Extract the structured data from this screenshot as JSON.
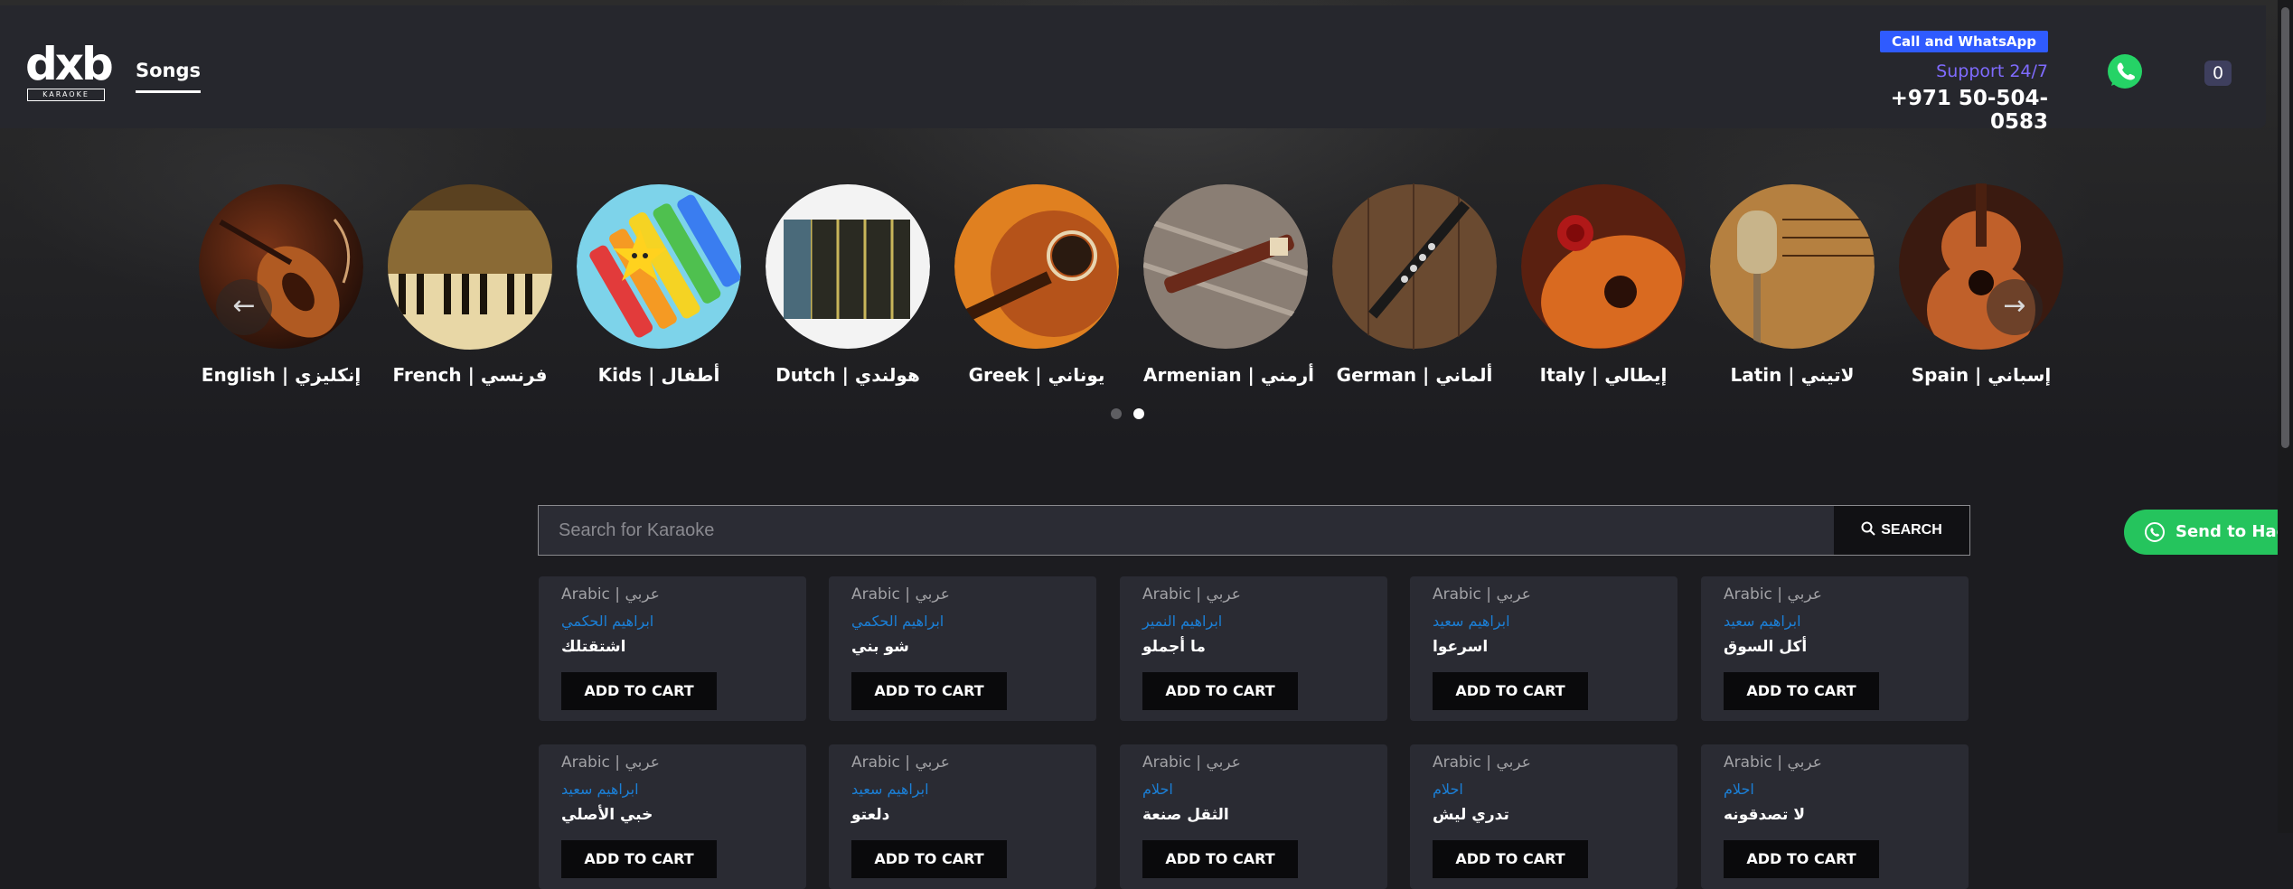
{
  "header": {
    "logo_text": "dxb",
    "logo_sub": "KARAOKE",
    "nav_songs": "Songs",
    "call_badge": "Call and WhatsApp",
    "support": "Support 24/7",
    "phone": "+971 50-504-0583",
    "cart_count": "0",
    "whatsapp_icon": "whatsapp-icon"
  },
  "categories": [
    {
      "label": "English | إنكليزي",
      "icon": "violin"
    },
    {
      "label": "French | فرنسي",
      "icon": "piano"
    },
    {
      "label": "Kids | أطفال",
      "icon": "xylophone"
    },
    {
      "label": "Dutch | هولندي",
      "icon": "accordion"
    },
    {
      "label": "Greek | يوناني",
      "icon": "bouzouki"
    },
    {
      "label": "Armenian | أرمني",
      "icon": "duduk"
    },
    {
      "label": "German | ألماني",
      "icon": "clarinet"
    },
    {
      "label": "Italy | إيطالي",
      "icon": "guitar-rose"
    },
    {
      "label": "Latin | لاتيني",
      "icon": "microphone"
    },
    {
      "label": "Spain | إسباني",
      "icon": "guitar"
    }
  ],
  "carousel": {
    "prev_icon": "arrow-left-icon",
    "next_icon": "arrow-right-icon",
    "pages": 2,
    "active_page": 2
  },
  "search": {
    "placeholder": "Search for Karaoke",
    "button_label": "SEARCH"
  },
  "whatsapp_float": {
    "label": "Send to Hadi"
  },
  "songs": [
    {
      "lang": "Arabic | عربي",
      "artist": "ابراهيم الحكمي",
      "title": "اشتقتلك",
      "button": "ADD TO CART"
    },
    {
      "lang": "Arabic | عربي",
      "artist": "ابراهيم الحكمي",
      "title": "شو بني",
      "button": "ADD TO CART"
    },
    {
      "lang": "Arabic | عربي",
      "artist": "ابراهيم النمير",
      "title": "ما أجملو",
      "button": "ADD TO CART"
    },
    {
      "lang": "Arabic | عربي",
      "artist": "ابراهيم سعيد",
      "title": "اسرعوا",
      "button": "ADD TO CART"
    },
    {
      "lang": "Arabic | عربي",
      "artist": "ابراهيم سعيد",
      "title": "أكل السوق",
      "button": "ADD TO CART"
    },
    {
      "lang": "Arabic | عربي",
      "artist": "ابراهيم سعيد",
      "title": "خبي الأصلي",
      "button": "ADD TO CART"
    },
    {
      "lang": "Arabic | عربي",
      "artist": "ابراهيم سعيد",
      "title": "دلعتو",
      "button": "ADD TO CART"
    },
    {
      "lang": "Arabic | عربي",
      "artist": "احلام",
      "title": "الثقل صنعة",
      "button": "ADD TO CART"
    },
    {
      "lang": "Arabic | عربي",
      "artist": "احلام",
      "title": "تدري ليش",
      "button": "ADD TO CART"
    },
    {
      "lang": "Arabic | عربي",
      "artist": "احلام",
      "title": "لا تصدقونه",
      "button": "ADD TO CART"
    }
  ],
  "colors": {
    "accent_blue": "#2f5bff",
    "support_purple": "#7f6bff",
    "whatsapp_green": "#25c45d",
    "artist_link": "#1b7fd6"
  }
}
